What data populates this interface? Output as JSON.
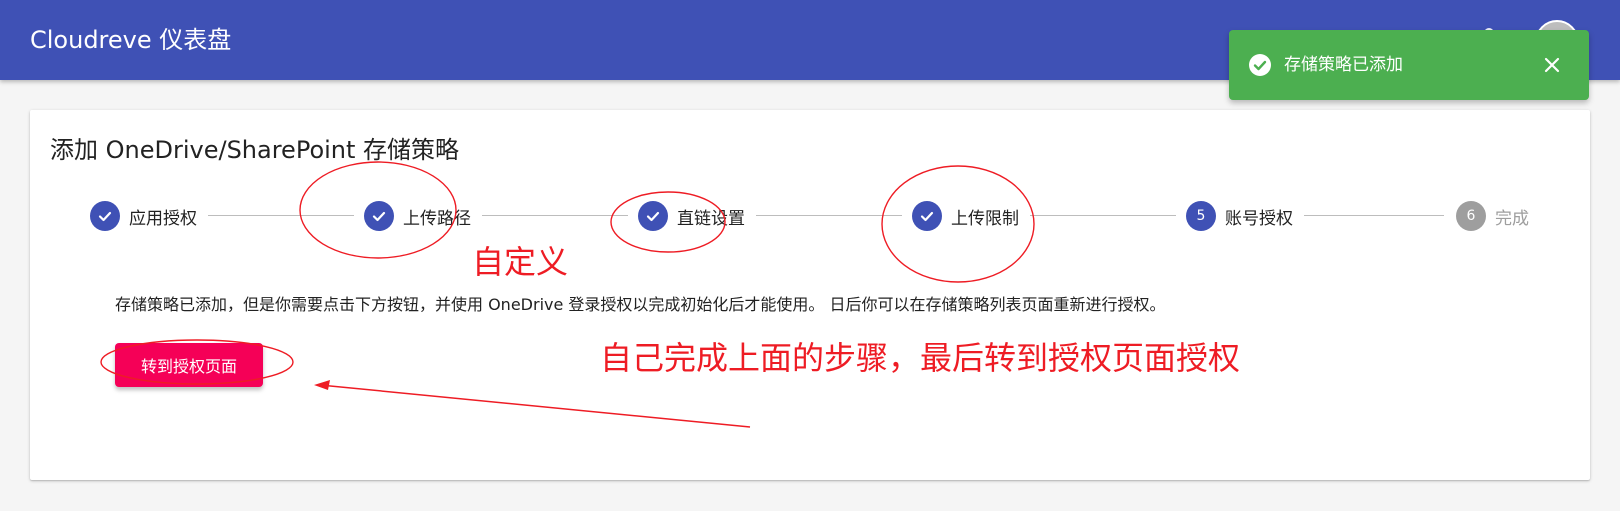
{
  "appbar": {
    "title": "Cloudreve 仪表盘"
  },
  "snackbar": {
    "message": "存储策略已添加",
    "icon": "check-circle-icon",
    "close_icon": "close-icon",
    "color": "#4caf50"
  },
  "card": {
    "title": "添加 OneDrive/SharePoint 存储策略"
  },
  "stepper": {
    "steps": [
      {
        "label": "应用授权",
        "status": "done",
        "number": ""
      },
      {
        "label": "上传路径",
        "status": "done",
        "number": ""
      },
      {
        "label": "直链设置",
        "status": "done",
        "number": ""
      },
      {
        "label": "上传限制",
        "status": "done",
        "number": ""
      },
      {
        "label": "账号授权",
        "status": "active",
        "number": "5"
      },
      {
        "label": "完成",
        "status": "todo",
        "number": "6"
      }
    ]
  },
  "description": "存储策略已添加，但是你需要点击下方按钮，并使用 OneDrive 登录授权以完成初始化后才能使用。 日后你可以在存储策略列表页面重新进行授权。",
  "primary_button": {
    "label": "转到授权页面",
    "color": "#f50057"
  },
  "annotations": {
    "custom_label": "自定义",
    "instruction": "自己完成上面的步骤，最后转到授权页面授权",
    "color": "#ee1c24"
  },
  "theme": {
    "primary": "#3f51b5",
    "inactive": "#9e9e9e"
  }
}
